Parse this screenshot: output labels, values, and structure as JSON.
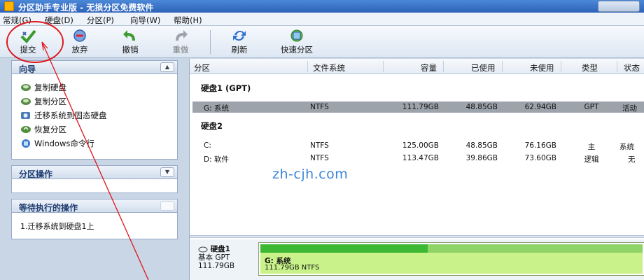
{
  "app": {
    "title": "分区助手专业版 - 无损分区免费软件"
  },
  "menu": [
    {
      "id": "general",
      "label": "常规(G)"
    },
    {
      "id": "disk",
      "label": "硬盘(D)"
    },
    {
      "id": "partition",
      "label": "分区(P)"
    },
    {
      "id": "wizard",
      "label": "向导(W)"
    },
    {
      "id": "help",
      "label": "帮助(H)"
    }
  ],
  "toolbar": {
    "commit": "提交",
    "discard": "放弃",
    "undo": "撤销",
    "redo": "重做",
    "refresh": "刷新",
    "quick_partition": "快速分区"
  },
  "wizard_panel": {
    "title": "向导",
    "items": [
      {
        "label": "复制硬盘",
        "icon": "copy-disk-icon"
      },
      {
        "label": "复制分区",
        "icon": "copy-partition-icon"
      },
      {
        "label": "迁移系统到固态硬盘",
        "icon": "migrate-os-icon"
      },
      {
        "label": "恢复分区",
        "icon": "recover-partition-icon"
      },
      {
        "label": "Windows命令行",
        "icon": "windows-cmd-icon"
      }
    ]
  },
  "partition_ops_panel": {
    "title": "分区操作"
  },
  "pending_panel": {
    "title": "等待执行的操作",
    "items": [
      "1.迁移系统到硬盘1上"
    ]
  },
  "table": {
    "columns": [
      "分区",
      "文件系统",
      "容量",
      "已使用",
      "未使用",
      "类型",
      "状态"
    ],
    "groups": [
      {
        "name": "硬盘1 (GPT)",
        "rows": [
          {
            "partition": "G: 系统",
            "fs": "NTFS",
            "capacity": "111.79GB",
            "used": "48.85GB",
            "free": "62.94GB",
            "type": "GPT",
            "status": "活动",
            "selected": true
          }
        ]
      },
      {
        "name": "硬盘2",
        "rows": [
          {
            "partition": "C:",
            "fs": "NTFS",
            "capacity": "125.00GB",
            "used": "48.85GB",
            "free": "76.16GB",
            "type": "主",
            "status": "系统",
            "selected": false
          },
          {
            "partition": "D: 软件",
            "fs": "NTFS",
            "capacity": "113.47GB",
            "used": "39.86GB",
            "free": "73.60GB",
            "type": "逻辑",
            "status": "无",
            "selected": false
          }
        ]
      }
    ]
  },
  "watermark": "zh-cjh.com",
  "disk_map": {
    "disk_name": "硬盘1",
    "disk_type": "基本 GPT",
    "disk_size": "111.79GB",
    "partition_name": "G: 系统",
    "partition_size": "111.79GB NTFS",
    "used_fraction": 0.437
  },
  "colors": {
    "selected_row": "#9da3ab",
    "partition_used": "#3cb832",
    "partition_free": "#8fd466",
    "partition_body": "#c9f38a",
    "annotation": "#e0161b"
  }
}
